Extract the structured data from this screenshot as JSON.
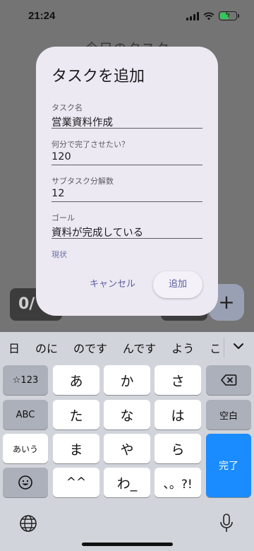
{
  "status": {
    "time": "21:24"
  },
  "background": {
    "title": "今日のタスク",
    "counter": "0/",
    "fab": "+"
  },
  "dialog": {
    "title": "タスクを追加",
    "fields": [
      {
        "label": "タスク名",
        "value": "営業資料作成"
      },
      {
        "label": "何分で完了させたい？",
        "value": "120"
      },
      {
        "label": "サブタスク分解数",
        "value": "12"
      },
      {
        "label": "ゴール",
        "value": "資料が完成している"
      },
      {
        "label": "現状",
        "value": ""
      }
    ],
    "cancel_label": "キャンセル",
    "add_label": "追加"
  },
  "keyboard": {
    "suggestions": [
      "日",
      "のに",
      "のです",
      "んです",
      "よう",
      "こ"
    ],
    "keys": {
      "symbols": "☆123",
      "abc": "ABC",
      "aiu": "あいう",
      "a": "あ",
      "ka": "か",
      "sa": "さ",
      "ta": "た",
      "na": "な",
      "ha": "は",
      "ma": "ま",
      "ya": "や",
      "ra": "ら",
      "kaomoji": "^^",
      "wa": "わ_",
      "punct": "、。?!",
      "space": "空白",
      "done": "完了"
    }
  }
}
